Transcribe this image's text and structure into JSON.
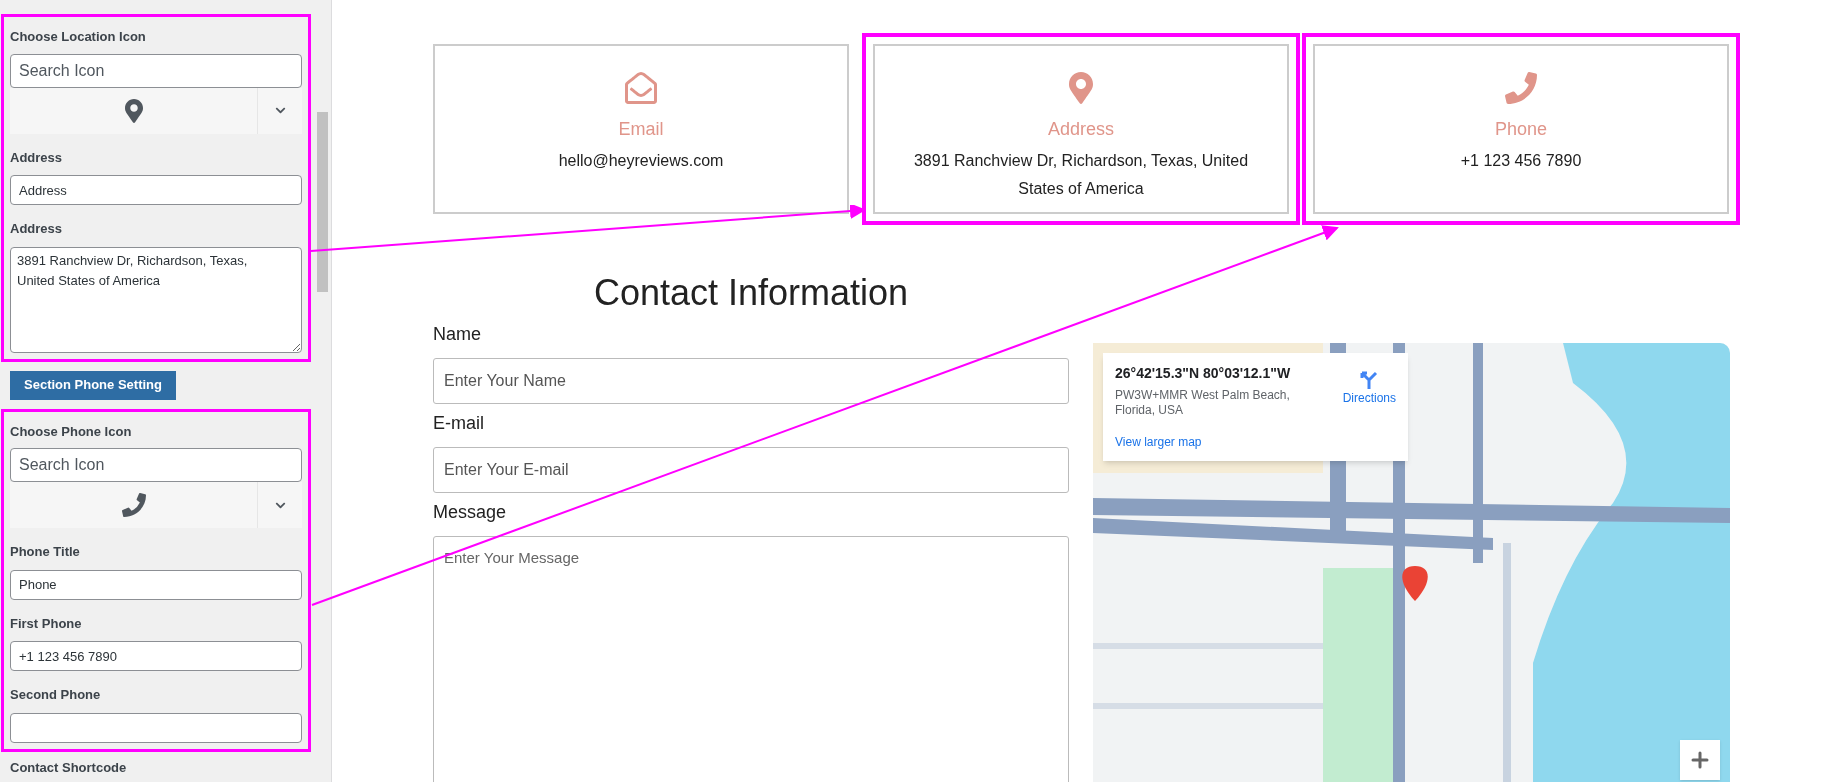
{
  "settings_panel": {
    "sections": [
      {
        "icon_label": "Choose Location Icon",
        "kind": "location",
        "search": {
          "placeholder": "Search Icon"
        },
        "highlighted": true,
        "fields": [
          {
            "label": "Address",
            "kind": "input",
            "value": "Address"
          },
          {
            "label": "Address",
            "kind": "textarea",
            "value": "3891 Ranchview Dr, Richardson, Texas, United States of America"
          }
        ]
      },
      {
        "button": "Section Phone Setting",
        "icon_label": "Choose Phone Icon",
        "kind": "phone",
        "search": {
          "placeholder": "Search Icon"
        },
        "highlighted": true,
        "fields": [
          {
            "label": "Phone Title",
            "kind": "input",
            "value": "Phone"
          },
          {
            "label": "First Phone",
            "kind": "input",
            "value": "+1 123 456 7890"
          },
          {
            "label": "Second Phone",
            "kind": "input"
          }
        ]
      }
    ],
    "footer_label": "Contact Shortcode"
  },
  "info_cards": [
    {
      "kind": "email",
      "title": "Email",
      "text": "hello@heyreviews.com",
      "highlighted": false
    },
    {
      "kind": "location",
      "title": "Address",
      "text": "3891 Ranchview Dr, Richardson, Texas, United States of America",
      "highlighted": true
    },
    {
      "kind": "phone",
      "title": "Phone",
      "text": "+1 123 456 7890",
      "highlighted": true
    }
  ],
  "contact_form": {
    "heading": "Contact Information",
    "fields": [
      {
        "label": "Name",
        "kind": "input",
        "placeholder": "Enter Your Name"
      },
      {
        "label": "E-mail",
        "kind": "input",
        "placeholder": "Enter Your E-mail"
      },
      {
        "label": "Message",
        "kind": "textarea",
        "placeholder": "Enter Your Message"
      }
    ]
  },
  "map": {
    "coordinates": "26°42'15.3\"N 80°03'12.1\"W",
    "address": "PW3W+MMR West Palm Beach, Florida, USA",
    "directions": "Directions",
    "larger_map": "View larger map"
  }
}
